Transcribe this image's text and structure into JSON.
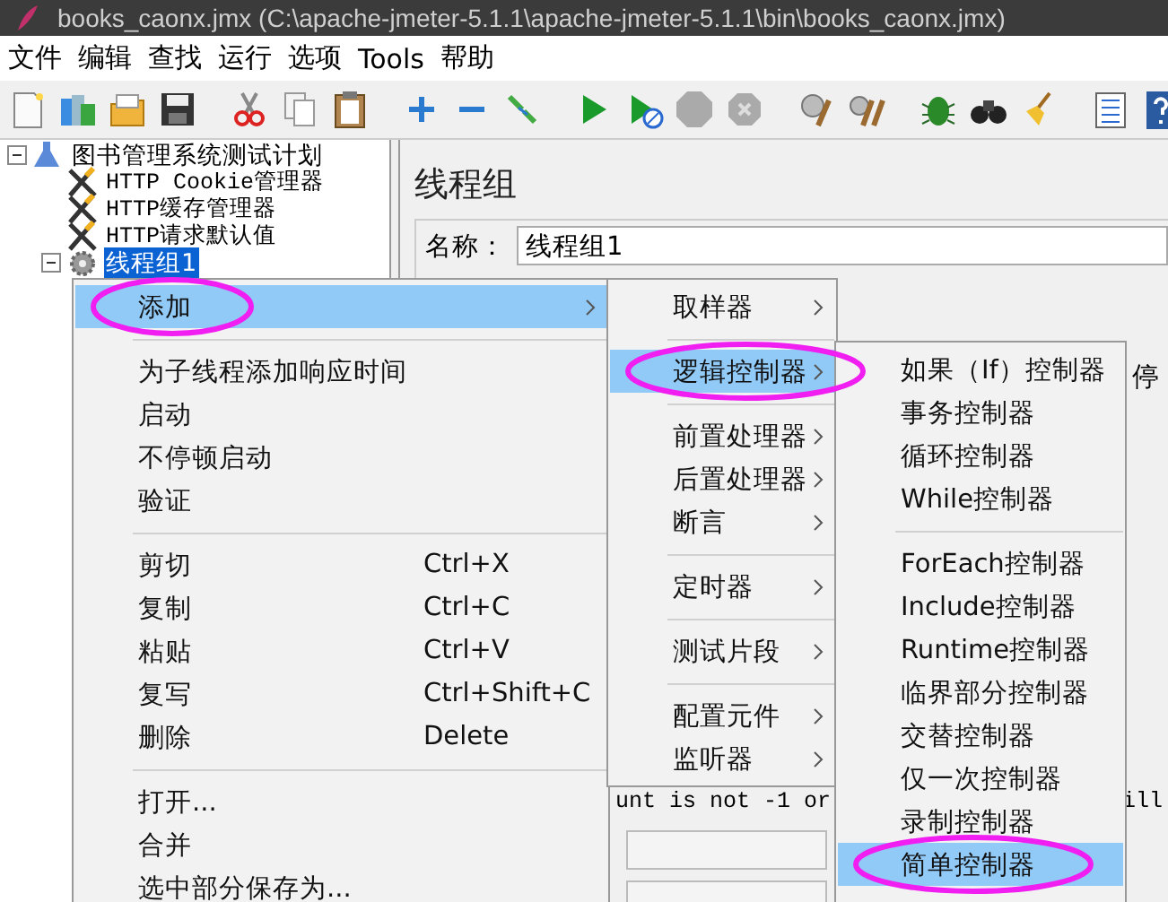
{
  "window": {
    "title": "books_caonx.jmx (C:\\apache-jmeter-5.1.1\\apache-jmeter-5.1.1\\bin\\books_caonx.jmx)"
  },
  "menu_bar": [
    "文件",
    "编辑",
    "查找",
    "运行",
    "选项",
    "Tools",
    "帮助"
  ],
  "tree": {
    "items": [
      {
        "label": "图书管理系统测试计划",
        "kind": "plan",
        "expanded": true,
        "selected": false,
        "children": [
          {
            "label": "HTTP Cookie管理器",
            "kind": "config",
            "selected": false
          },
          {
            "label": "HTTP缓存管理器",
            "kind": "config",
            "selected": false
          },
          {
            "label": "HTTP请求默认值",
            "kind": "config",
            "selected": false
          },
          {
            "label": "线程组1",
            "kind": "thread_group",
            "expanded": true,
            "selected": true
          }
        ]
      }
    ]
  },
  "panel": {
    "heading": "线程组",
    "name_label": "名称：",
    "name_value": "线程组1",
    "side_text": "停",
    "note_text": "unt is not -1 or",
    "note_text_end": "ill"
  },
  "context_menu": {
    "items": [
      {
        "kind": "item",
        "label": "添加",
        "has_submenu": true,
        "selected": true,
        "circled": true
      },
      {
        "kind": "separator"
      },
      {
        "kind": "item",
        "label": "为子线程添加响应时间",
        "has_submenu": false,
        "selected": false,
        "circled": false
      },
      {
        "kind": "item",
        "label": "启动",
        "has_submenu": false,
        "selected": false,
        "circled": false
      },
      {
        "kind": "item",
        "label": "不停顿启动",
        "has_submenu": false,
        "selected": false,
        "circled": false
      },
      {
        "kind": "item",
        "label": "验证",
        "has_submenu": false,
        "selected": false,
        "circled": false
      },
      {
        "kind": "separator"
      },
      {
        "kind": "item",
        "label": "剪切",
        "shortcut": "Ctrl+X",
        "has_submenu": false,
        "selected": false,
        "circled": false
      },
      {
        "kind": "item",
        "label": "复制",
        "shortcut": "Ctrl+C",
        "has_submenu": false,
        "selected": false,
        "circled": false
      },
      {
        "kind": "item",
        "label": "粘贴",
        "shortcut": "Ctrl+V",
        "has_submenu": false,
        "selected": false,
        "circled": false
      },
      {
        "kind": "item",
        "label": "复写",
        "shortcut": "Ctrl+Shift+C",
        "has_submenu": false,
        "selected": false,
        "circled": false
      },
      {
        "kind": "item",
        "label": "删除",
        "shortcut": "Delete",
        "has_submenu": false,
        "selected": false,
        "circled": false
      },
      {
        "kind": "separator"
      },
      {
        "kind": "item",
        "label": "打开...",
        "has_submenu": false,
        "selected": false,
        "circled": false
      },
      {
        "kind": "item",
        "label": "合并",
        "has_submenu": false,
        "selected": false,
        "circled": false
      },
      {
        "kind": "item",
        "label": "选中部分保存为...",
        "has_submenu": false,
        "selected": false,
        "circled": false
      }
    ]
  },
  "add_submenu": {
    "items": [
      {
        "kind": "item",
        "label": "取样器",
        "has_submenu": true,
        "selected": false,
        "circled": false
      },
      {
        "kind": "separator"
      },
      {
        "kind": "item",
        "label": "逻辑控制器",
        "has_submenu": true,
        "selected": true,
        "circled": true
      },
      {
        "kind": "separator"
      },
      {
        "kind": "item",
        "label": "前置处理器",
        "has_submenu": true,
        "selected": false,
        "circled": false
      },
      {
        "kind": "item",
        "label": "后置处理器",
        "has_submenu": true,
        "selected": false,
        "circled": false
      },
      {
        "kind": "item",
        "label": "断言",
        "has_submenu": true,
        "selected": false,
        "circled": false
      },
      {
        "kind": "separator"
      },
      {
        "kind": "item",
        "label": "定时器",
        "has_submenu": true,
        "selected": false,
        "circled": false
      },
      {
        "kind": "separator"
      },
      {
        "kind": "item",
        "label": "测试片段",
        "has_submenu": true,
        "selected": false,
        "circled": false
      },
      {
        "kind": "separator"
      },
      {
        "kind": "item",
        "label": "配置元件",
        "has_submenu": true,
        "selected": false,
        "circled": false
      },
      {
        "kind": "item",
        "label": "监听器",
        "has_submenu": true,
        "selected": false,
        "circled": false
      }
    ]
  },
  "logic_controller_submenu": {
    "items": [
      {
        "kind": "item",
        "label": "如果（If）控制器",
        "has_submenu": false,
        "selected": false,
        "circled": false
      },
      {
        "kind": "item",
        "label": "事务控制器",
        "has_submenu": false,
        "selected": false,
        "circled": false
      },
      {
        "kind": "item",
        "label": "循环控制器",
        "has_submenu": false,
        "selected": false,
        "circled": false
      },
      {
        "kind": "item",
        "label": "While控制器",
        "has_submenu": false,
        "selected": false,
        "circled": false
      },
      {
        "kind": "separator"
      },
      {
        "kind": "item",
        "label": "ForEach控制器",
        "has_submenu": false,
        "selected": false,
        "circled": false
      },
      {
        "kind": "item",
        "label": "Include控制器",
        "has_submenu": false,
        "selected": false,
        "circled": false
      },
      {
        "kind": "item",
        "label": "Runtime控制器",
        "has_submenu": false,
        "selected": false,
        "circled": false
      },
      {
        "kind": "item",
        "label": "临界部分控制器",
        "has_submenu": false,
        "selected": false,
        "circled": false
      },
      {
        "kind": "item",
        "label": "交替控制器",
        "has_submenu": false,
        "selected": false,
        "circled": false
      },
      {
        "kind": "item",
        "label": "仅一次控制器",
        "has_submenu": false,
        "selected": false,
        "circled": false
      },
      {
        "kind": "item",
        "label": "录制控制器",
        "has_submenu": false,
        "selected": false,
        "circled": false
      },
      {
        "kind": "item",
        "label": "简单控制器",
        "has_submenu": false,
        "selected": true,
        "circled": true
      }
    ]
  }
}
